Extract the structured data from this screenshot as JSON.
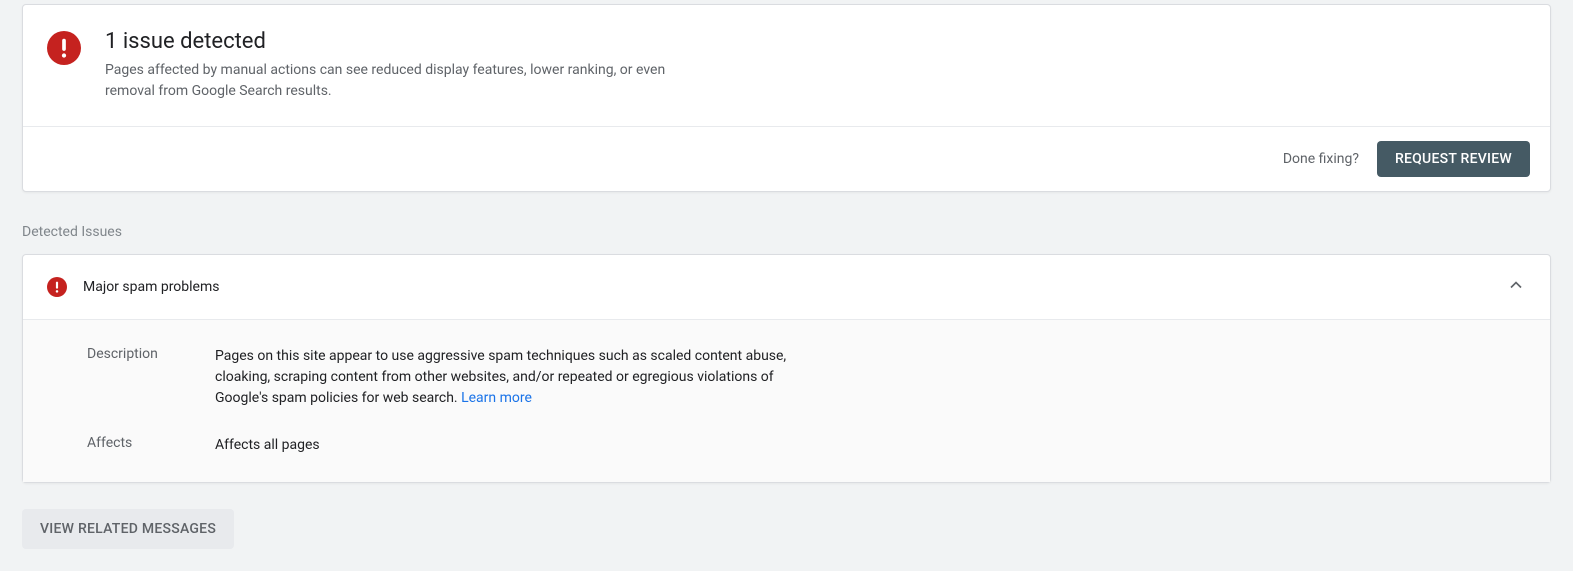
{
  "header": {
    "title": "1 issue detected",
    "description": "Pages affected by manual actions can see reduced display features, lower ranking, or even removal from Google Search results.",
    "done_fixing_label": "Done fixing?",
    "request_review_label": "REQUEST REVIEW"
  },
  "section_label": "Detected Issues",
  "issue": {
    "title": "Major spam problems",
    "description_label": "Description",
    "description_value": "Pages on this site appear to use aggressive spam techniques such as scaled content abuse, cloaking, scraping content from other websites, and/or repeated or egregious violations of Google's spam policies for web search. ",
    "learn_more": "Learn more",
    "affects_label": "Affects",
    "affects_value": "Affects all pages"
  },
  "view_messages_label": "VIEW RELATED MESSAGES"
}
